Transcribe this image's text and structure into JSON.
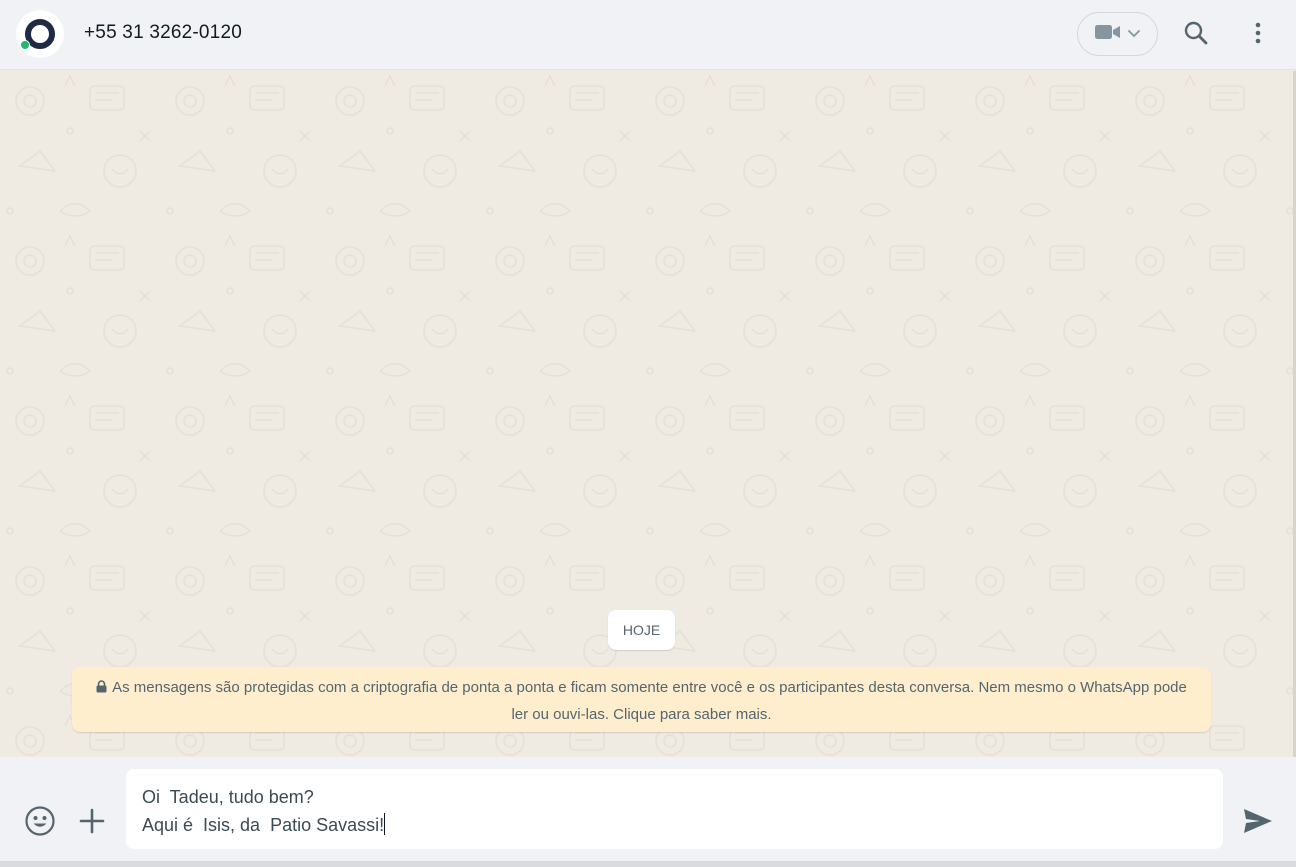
{
  "header": {
    "contact_name": "+55 31 3262-0120"
  },
  "icons": {
    "video": "video-camera-icon",
    "chevron": "chevron-down-icon",
    "search": "search-icon",
    "menu": "more-vertical-icon",
    "lock": "lock-icon",
    "emoji": "emoji-icon",
    "attach": "plus-icon",
    "send": "send-icon"
  },
  "chat": {
    "date_label": "HOJE",
    "encryption_notice": "As mensagens são protegidas com a criptografia de ponta a ponta e ficam somente entre você e os participantes desta conversa. Nem mesmo o WhatsApp pode ler ou ouvi-las. Clique para saber mais."
  },
  "composer": {
    "line1": "Oi  Tadeu, tudo bem?",
    "line2": "Aqui é  Isis, da  Patio Savassi!"
  },
  "colors": {
    "header_bg": "#f0f2f5",
    "chat_bg": "#efeae2",
    "notice_bg": "#ffeecd",
    "icon_gray": "#54656f",
    "online_green": "#25b96b",
    "avatar_ring": "#1f2a44"
  }
}
